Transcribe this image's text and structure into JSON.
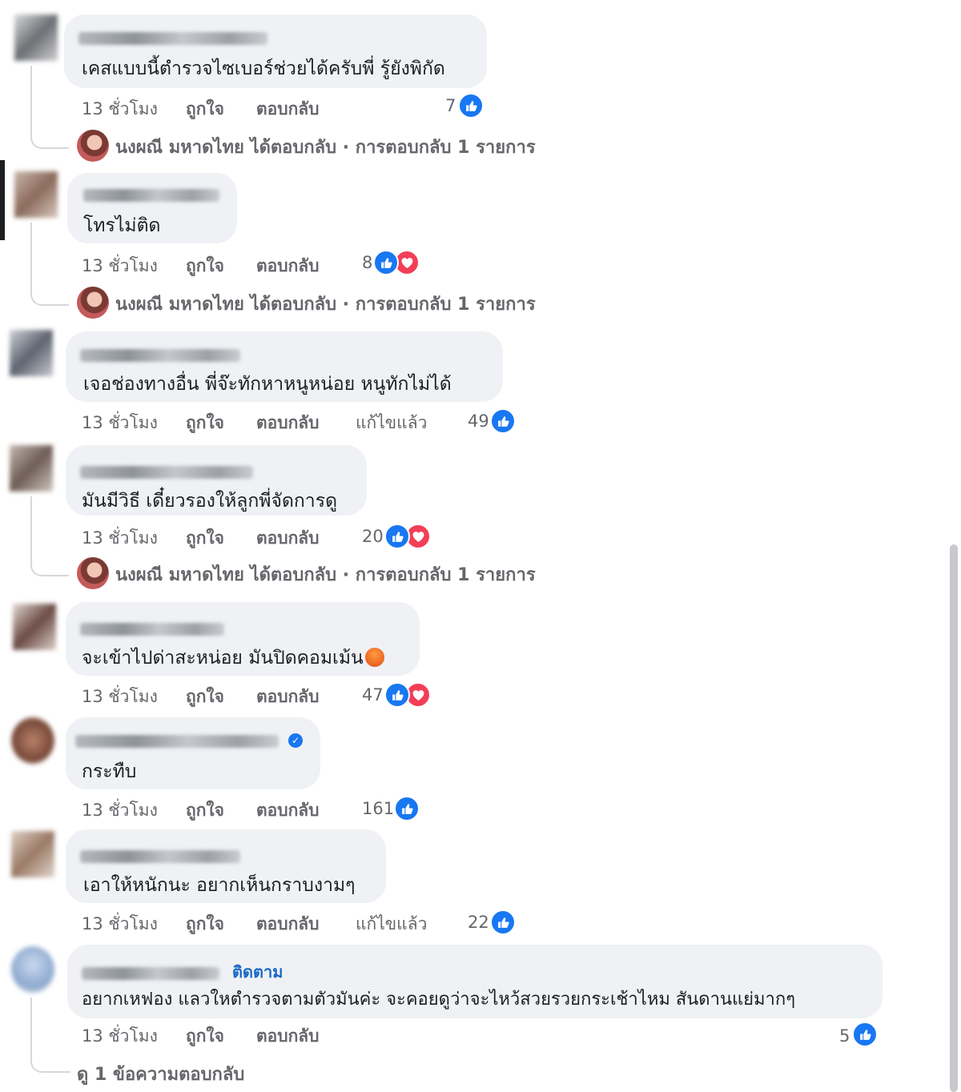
{
  "comments": [
    {
      "text": "เคสแบบนี้ตำรวจไซเบอร์ช่วยได้ครับพี่ รู้ยังพิกัด",
      "time": "13 ชั่วโมง",
      "like": "ถูกใจ",
      "reply": "ตอบกลับ",
      "edited": "",
      "count": "7",
      "reactions": [
        "like"
      ],
      "replies_summary": "นงผณี มหาดไทย ได้ตอบกลับ · การตอบกลับ 1 รายการ"
    },
    {
      "text": "โทรไม่ติด",
      "time": "13 ชั่วโมง",
      "like": "ถูกใจ",
      "reply": "ตอบกลับ",
      "edited": "",
      "count": "8",
      "reactions": [
        "like",
        "love"
      ],
      "replies_summary": "นงผณี มหาดไทย ได้ตอบกลับ · การตอบกลับ 1 รายการ"
    },
    {
      "text": "เจอช่องทางอื่น พี่จ๊ะทักหาหนูหน่อย หนูทักไม่ได้",
      "time": "13 ชั่วโมง",
      "like": "ถูกใจ",
      "reply": "ตอบกลับ",
      "edited": "แก้ไขแล้ว",
      "count": "49",
      "reactions": [
        "like"
      ]
    },
    {
      "text": "มันมีวิธี เดี๋ยวรองให้ลูกพี่จัดการดู",
      "time": "13 ชั่วโมง",
      "like": "ถูกใจ",
      "reply": "ตอบกลับ",
      "edited": "",
      "count": "20",
      "reactions": [
        "like",
        "love"
      ],
      "replies_summary": "นงผณี มหาดไทย ได้ตอบกลับ · การตอบกลับ 1 รายการ"
    },
    {
      "text": "จะเข้าไปด่าสะหน่อย มันปิดคอมเม้น",
      "emoji": "angry-face",
      "time": "13 ชั่วโมง",
      "like": "ถูกใจ",
      "reply": "ตอบกลับ",
      "edited": "",
      "count": "47",
      "reactions": [
        "like",
        "love"
      ]
    },
    {
      "text": "กระทืบ",
      "verified": true,
      "time": "13 ชั่วโมง",
      "like": "ถูกใจ",
      "reply": "ตอบกลับ",
      "edited": "",
      "count": "161",
      "reactions": [
        "like"
      ]
    },
    {
      "text": "เอาให้หนักนะ อยากเห็นกราบงามๆ",
      "time": "13 ชั่วโมง",
      "like": "ถูกใจ",
      "reply": "ตอบกลับ",
      "edited": "แก้ไขแล้ว",
      "count": "22",
      "reactions": [
        "like"
      ]
    },
    {
      "text": "อยากเหฟอง แลวใหตำรวจตามตัวมันค่ะ จะคอยดูว่าจะไหว้สวยรวยกระเช้าไหม สันดานแย่มากๆ",
      "follow": "ติดตาม",
      "time": "13 ชั่วโมง",
      "like": "ถูกใจ",
      "reply": "ตอบกลับ",
      "edited": "",
      "count": "5",
      "reactions": [
        "like"
      ],
      "view_replies": "ดู 1 ข้อความตอบกลับ"
    }
  ],
  "colors": {
    "bubble": "#eff1f4",
    "like": "#1877f2",
    "love": "#f33e58",
    "meta": "#65676b",
    "link": "#1a68c8"
  }
}
